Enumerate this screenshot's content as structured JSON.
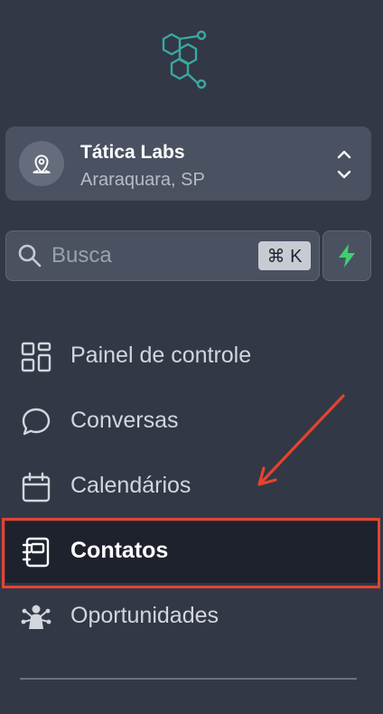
{
  "location": {
    "name": "Tática Labs",
    "city": "Araraquara, SP"
  },
  "search": {
    "placeholder": "Busca",
    "shortcut": "⌘ K"
  },
  "nav": {
    "items": [
      {
        "label": "Painel de controle",
        "icon": "dashboard-icon"
      },
      {
        "label": "Conversas",
        "icon": "chat-bubble-icon"
      },
      {
        "label": "Calendários",
        "icon": "calendar-icon"
      },
      {
        "label": "Contatos",
        "icon": "contacts-book-icon",
        "active": true
      },
      {
        "label": "Oportunidades",
        "icon": "opportunities-icon"
      }
    ]
  },
  "colors": {
    "sidebar_bg": "#323846",
    "active_bg": "#1e222d",
    "highlight": "#e5432f",
    "brand_teal": "#3aa9a0",
    "bolt_green": "#3ecf6e"
  }
}
